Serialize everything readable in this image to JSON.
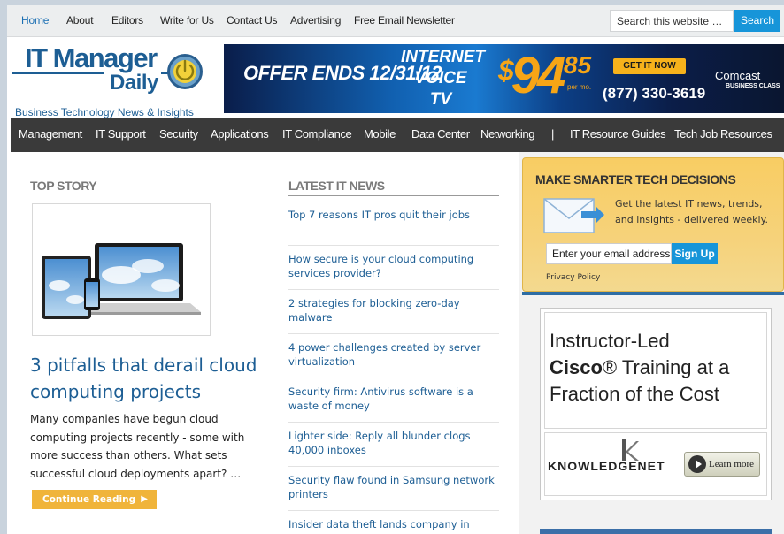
{
  "topnav": {
    "links": [
      "Home",
      "About",
      "Editors",
      "Write for Us",
      "Contact Us",
      "Advertising",
      "Free Email Newsletter"
    ],
    "search_placeholder": "Search this website …",
    "search_button": "Search"
  },
  "logo": {
    "line1": "IT Manager",
    "line2": "Daily",
    "tagline": "Business Technology News & Insights"
  },
  "banner": {
    "offer": "OFFER ENDS 12/31/12",
    "product_line1": "INTERNET",
    "product_line2": "VOICE",
    "product_line3": "TV",
    "price_dollar": "$",
    "price_whole": "94",
    "price_cents": "85",
    "per": "per mo.",
    "cta": "GET IT NOW",
    "phone": "(877) 330-3619",
    "brand": "Comcast",
    "brand_sub": "BUSINESS CLASS"
  },
  "categories": [
    "Management",
    "IT Support",
    "Security",
    "Applications",
    "IT Compliance",
    "Mobile",
    "Data Center",
    "Networking",
    "|",
    "IT Resource Guides",
    "Tech Job Resources"
  ],
  "top_story": {
    "section": "TOP STORY",
    "headline": "3 pitfalls that derail cloud computing projects",
    "summary": "Many companies have begun cloud computing projects recently - some with more success than others. What sets successful cloud deployments apart? …",
    "button": "Continue Reading",
    "button_arrow": "▶"
  },
  "latest": {
    "section": "LATEST IT NEWS",
    "items": [
      "Top 7 reasons IT pros quit their jobs",
      "How secure is your cloud computing services provider?",
      "2 strategies for blocking zero-day malware",
      "4 power challenges created by server virtualization",
      "Security firm: Antivirus software is a waste of money",
      "Lighter side: Reply all blunder clogs 40,000 inboxes",
      "Security flaw found in Samsung network printers",
      "Insider data theft lands company in court"
    ]
  },
  "signup": {
    "heading": "MAKE SMARTER TECH DECISIONS",
    "text": "Get the latest IT news, trends, and insights - delivered weekly.",
    "email_placeholder": "Enter your email address.",
    "button": "Sign Up",
    "privacy": "Privacy Policy"
  },
  "ad": {
    "line1": "Instructor-Led",
    "brand": "Cisco",
    "reg": "®",
    "line2_rest": " Training at a",
    "line3": "Fraction of the Cost",
    "company": "KNOWLEDGENET",
    "learn": "Learn more"
  },
  "colors": {
    "accent": "#1795d9",
    "link": "#1d5e94",
    "nav_dark": "#3a3a3a",
    "cta_orange": "#f0b43a"
  }
}
